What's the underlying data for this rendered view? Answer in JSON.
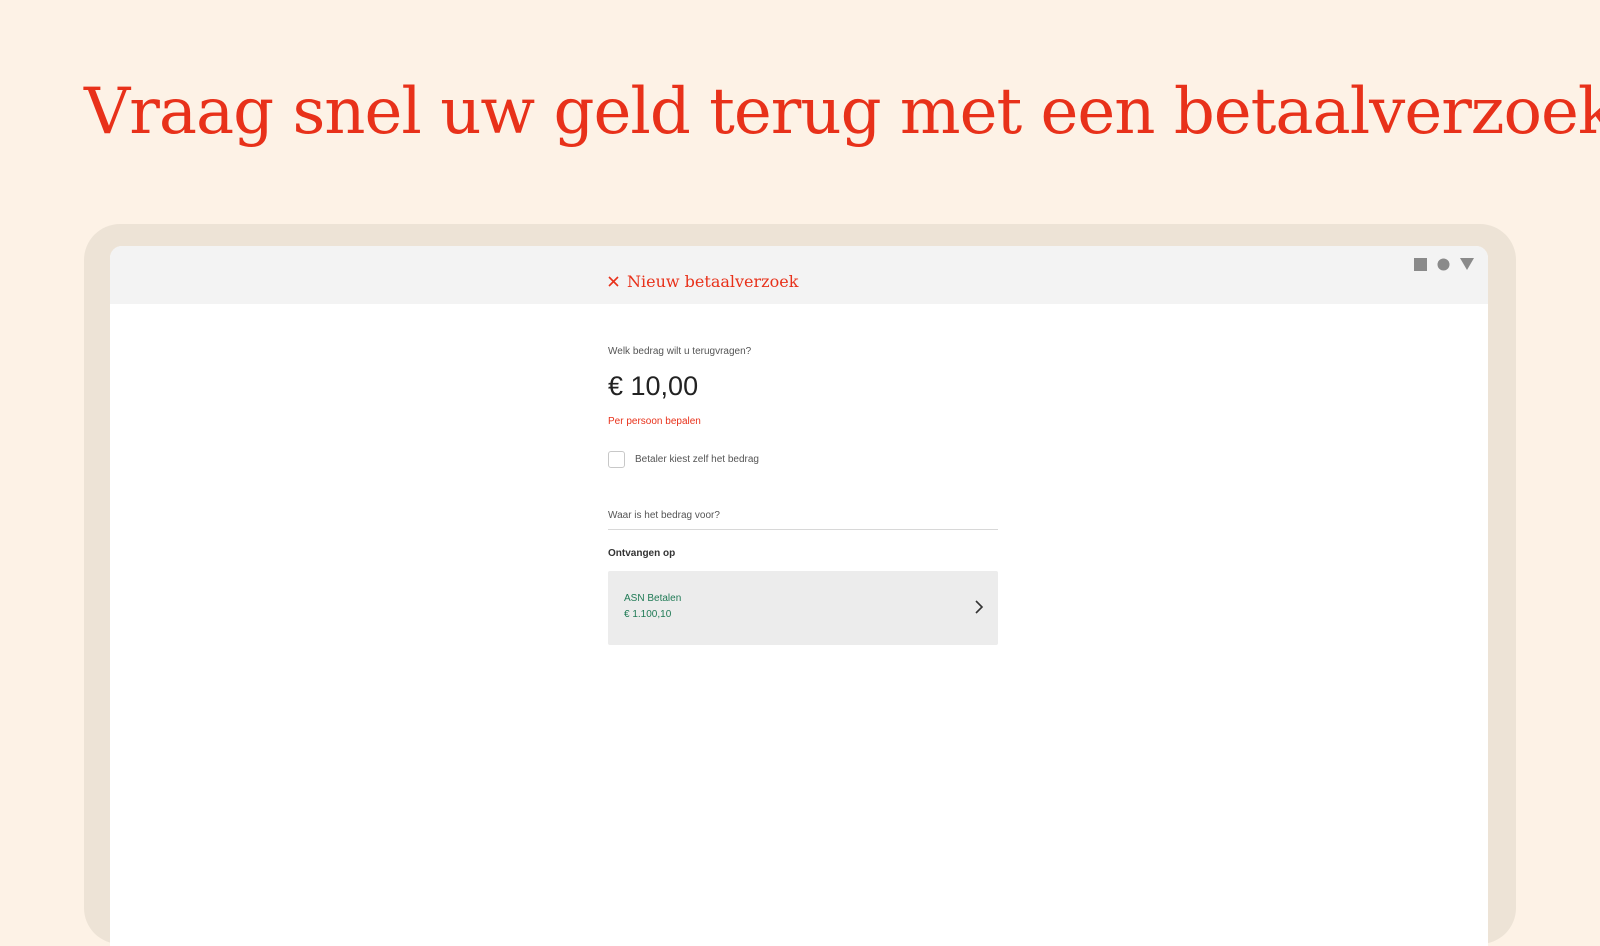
{
  "headline": "Vraag snel uw geld terug met een betaalverzoek",
  "screen": {
    "title": "Nieuw betaalverzoek",
    "status_icons": [
      "square-icon",
      "circle-icon",
      "triangle-icon"
    ],
    "amount_question": "Welk bedrag wilt u terugvragen?",
    "amount_value": "€ 10,00",
    "per_person_link": "Per persoon bepalen",
    "checkbox_label": "Betaler kiest zelf het bedrag",
    "description_placeholder": "Waar is het bedrag voor?",
    "receive_label": "Ontvangen op",
    "account": {
      "name": "ASN Betalen",
      "balance": "€ 1.100,10"
    }
  },
  "colors": {
    "accent": "#e8311a",
    "background": "#fdf2e6",
    "device_frame": "#ede3d6",
    "account_text": "#1f7a55"
  }
}
